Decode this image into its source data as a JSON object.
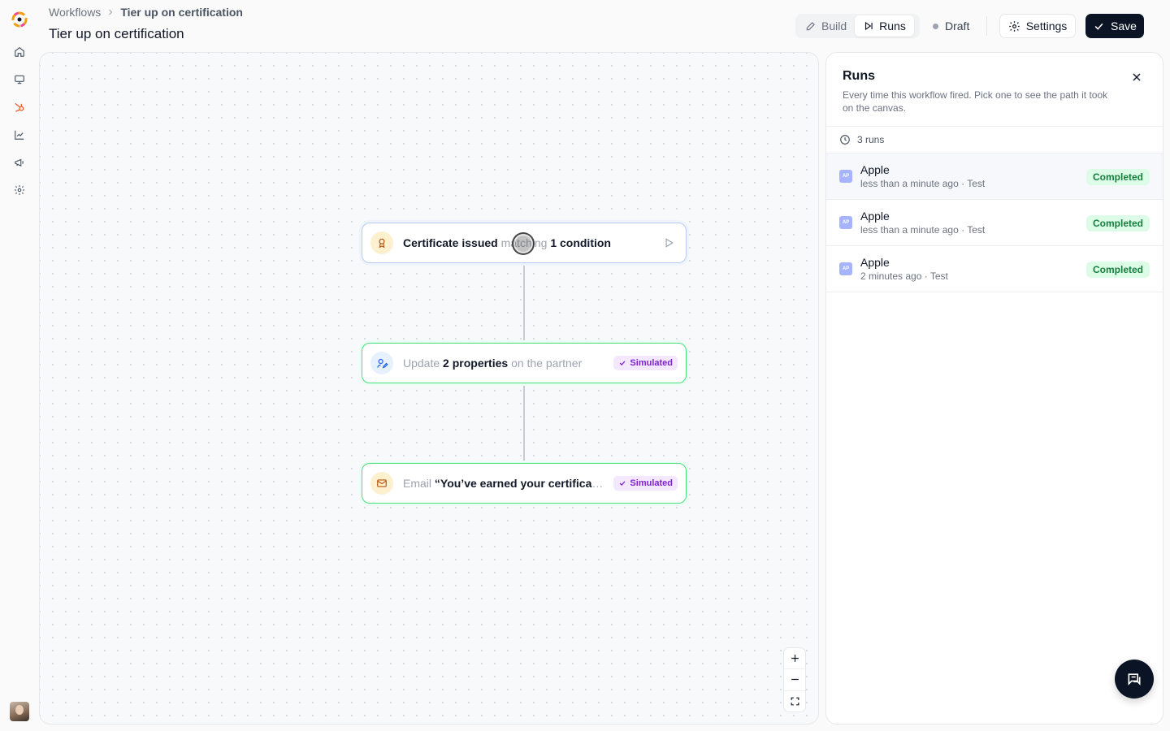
{
  "breadcrumb": {
    "root": "Workflows",
    "current": "Tier up on certification"
  },
  "page_title": "Tier up on certification",
  "modes": {
    "build": "Build",
    "runs": "Runs",
    "active": "runs"
  },
  "status": "Draft",
  "actions": {
    "settings": "Settings",
    "save": "Save"
  },
  "colors": {
    "accent": "#f05a28",
    "success": "#4ade80",
    "primary_dark": "#0b1424",
    "simulated": "#7e22ce"
  },
  "rail": [
    "home-icon",
    "monitor-icon",
    "hubspot-icon",
    "chart-line-icon",
    "megaphone-icon",
    "gear-icon"
  ],
  "nodes": {
    "trigger": {
      "strong1": "Certificate issued",
      "muted": " matching ",
      "strong2": "1 condition"
    },
    "update": {
      "muted1": "Update ",
      "strong": "2 properties",
      "muted2": " on the partner",
      "badge": "Simulated"
    },
    "email": {
      "muted": "Email ",
      "strong": "“You’ve earned your certificate”",
      "badge": "Simulated"
    }
  },
  "runs_panel": {
    "title": "Runs",
    "description": "Every time this workflow fired. Pick one to see the path it took on the canvas.",
    "count": "3 runs",
    "runs": [
      {
        "avatar": "AP",
        "name": "Apple",
        "meta": "less than a minute ago · Test",
        "status": "Completed"
      },
      {
        "avatar": "AP",
        "name": "Apple",
        "meta": "less than a minute ago · Test",
        "status": "Completed"
      },
      {
        "avatar": "AP",
        "name": "Apple",
        "meta": "2 minutes ago · Test",
        "status": "Completed"
      }
    ]
  }
}
